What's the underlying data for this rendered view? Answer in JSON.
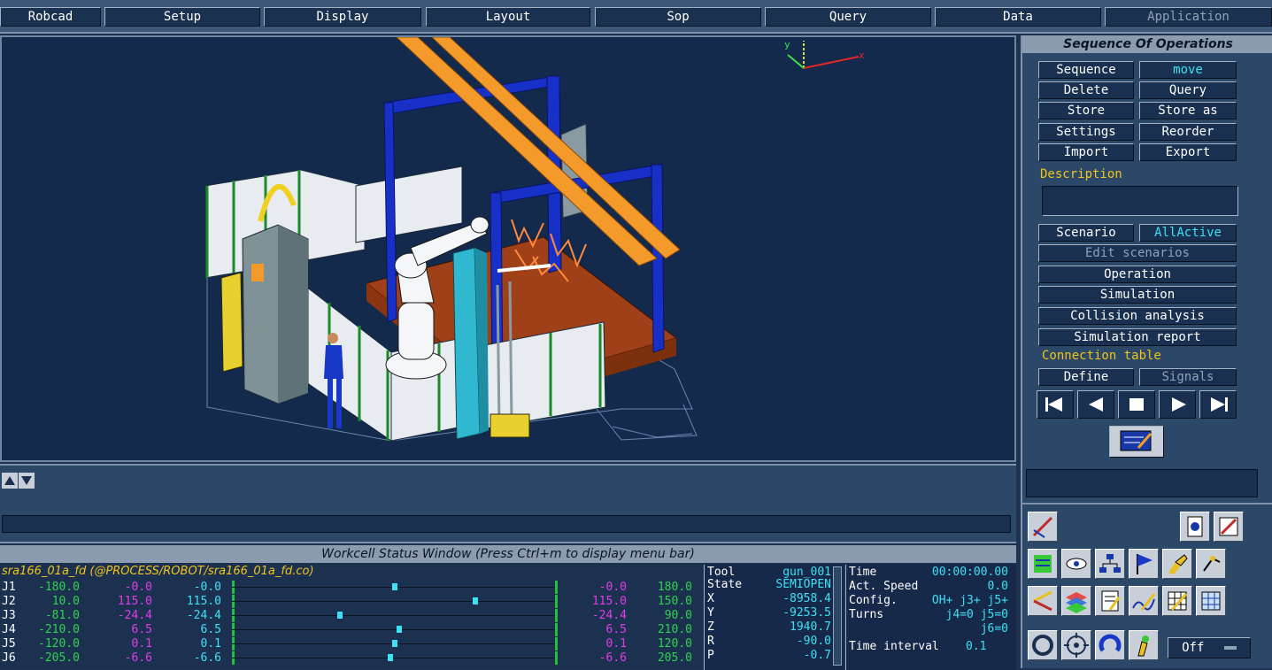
{
  "menu": {
    "items": [
      "Robcad",
      "Setup",
      "Display",
      "Layout",
      "Sop",
      "Query",
      "Data",
      "Application"
    ]
  },
  "viewport": {
    "axes": {
      "x": "x",
      "y": "y"
    }
  },
  "sop": {
    "title": "Sequence Of Operations",
    "sequence_label": "Sequence",
    "sequence_mode": "move",
    "delete_label": "Delete",
    "query_label": "Query",
    "store_label": "Store",
    "store_as_label": "Store as",
    "settings_label": "Settings",
    "reorder_label": "Reorder",
    "import_label": "Import",
    "export_label": "Export",
    "description_label": "Description",
    "description_value": "",
    "scenario_label": "Scenario",
    "scenario_value": "AllActive",
    "edit_scenarios_label": "Edit scenarios",
    "operation_label": "Operation",
    "simulation_label": "Simulation",
    "collision_label": "Collision analysis",
    "sim_report_label": "Simulation report",
    "connection_label": "Connection table",
    "define_label": "Define",
    "signals_label": "Signals"
  },
  "status": {
    "title": "Workcell Status Window  (Press Ctrl+m to display menu bar)",
    "robot_path": "sra166_01a_fd (@PROCESS/ROBOT/sra166_01a_fd.co)",
    "joints": [
      {
        "name": "J1",
        "lo": "-180.0",
        "v1": "-0.0",
        "v2": "-0.0",
        "min": "-0.0",
        "max": "180.0",
        "pos": 0.5
      },
      {
        "name": "J2",
        "lo": "10.0",
        "v1": "115.0",
        "v2": "115.0",
        "min": "115.0",
        "max": "150.0",
        "pos": 0.75
      },
      {
        "name": "J3",
        "lo": "-81.0",
        "v1": "-24.4",
        "v2": "-24.4",
        "min": "-24.4",
        "max": "90.0",
        "pos": 0.33
      },
      {
        "name": "J4",
        "lo": "-210.0",
        "v1": "6.5",
        "v2": "6.5",
        "min": "6.5",
        "max": "210.0",
        "pos": 0.515
      },
      {
        "name": "J5",
        "lo": "-120.0",
        "v1": "0.1",
        "v2": "0.1",
        "min": "0.1",
        "max": "120.0",
        "pos": 0.5
      },
      {
        "name": "J6",
        "lo": "-205.0",
        "v1": "-6.6",
        "v2": "-6.6",
        "min": "-6.6",
        "max": "205.0",
        "pos": 0.485
      }
    ],
    "tool": {
      "tool_label": "Tool",
      "tool_value": "gun_001",
      "state_label": "State",
      "state_value": "SEMIOPEN",
      "x_label": "X",
      "x_value": "-8958.4",
      "y_label": "Y",
      "y_value": "-9253.5",
      "z_label": "Z",
      "z_value": "1940.7",
      "r_label": "R",
      "r_value": "-90.0",
      "p_label": "P",
      "p_value": "-0.7"
    },
    "timing": {
      "time_label": "Time",
      "time_value": "00:00:00.00",
      "speed_label": "Act. Speed",
      "speed_value": "0.0",
      "config_label": "Config.",
      "config_value": "OH+  j3+  j5+",
      "turns_label": "Turns",
      "turns_value": "j4=0  j5=0",
      "turns_value2": "j6=0",
      "interval_label": "Time interval",
      "interval_value": "0.1"
    }
  },
  "toolbar": {
    "off_label": "Off"
  },
  "colors": {
    "bg": "#1f3350",
    "viewport": "#142a4d",
    "accent_yellow": "#f0c419",
    "accent_cyan": "#3ee0f5",
    "joint_green": "#2ed34e",
    "joint_magenta": "#e23ce8"
  }
}
